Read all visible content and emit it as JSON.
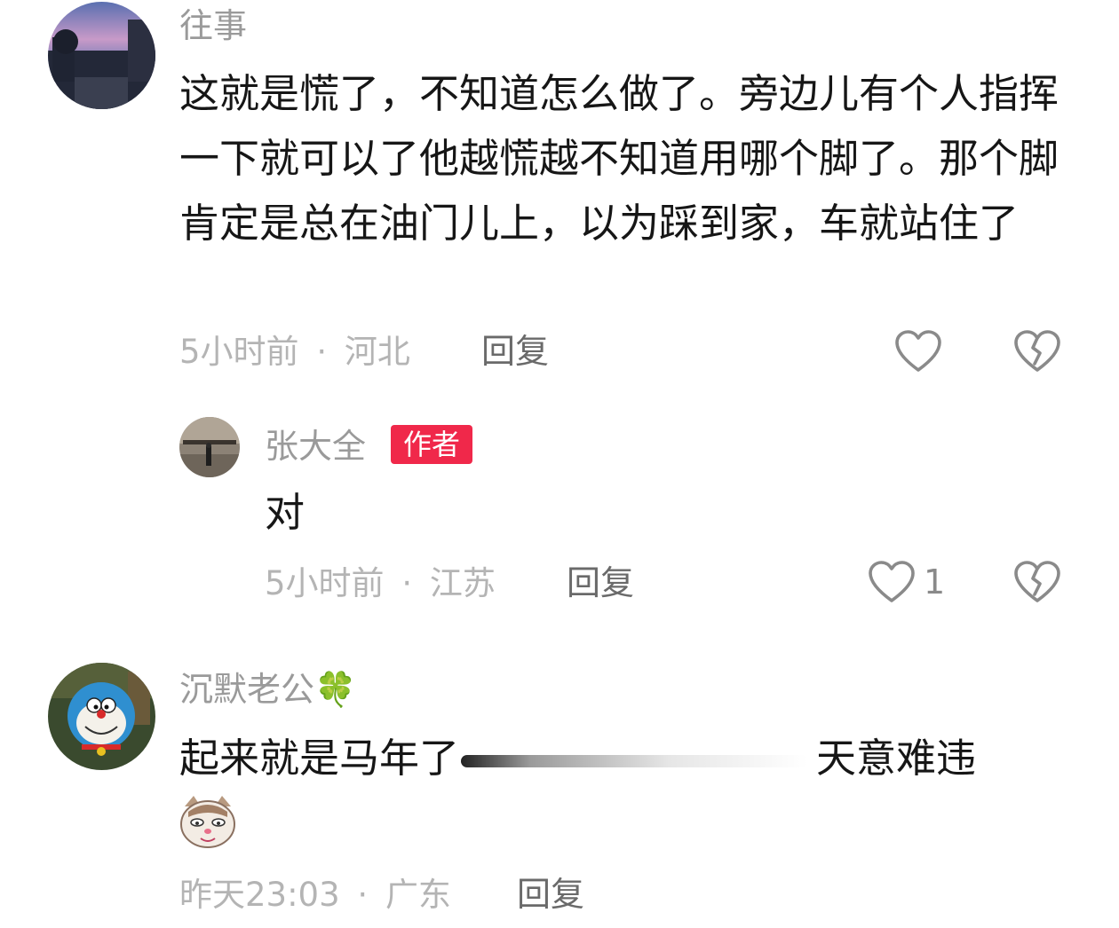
{
  "comments": [
    {
      "username": "往事",
      "text": "这就是慌了，不知道怎么做了。旁边儿有个人指挥一下就可以了他越慌越不知道用哪个脚了。那个脚肯定是总在油门儿上，以为踩到家，车就站住了",
      "time": "5小时前",
      "sep": "·",
      "location": "河北",
      "reply_label": "回复",
      "reply": {
        "username": "张大全",
        "badge": "作者",
        "text": "对",
        "time": "5小时前",
        "sep": "·",
        "location": "江苏",
        "reply_label": "回复",
        "like_count": "1"
      }
    },
    {
      "username": "沉默老公",
      "username_emoji": "🍀",
      "text_before": "起来就是马年了",
      "text_after": "天意难违",
      "time": "昨天23:03",
      "sep": "·",
      "location": "广东",
      "reply_label": "回复"
    }
  ],
  "icons": {
    "like": "heart-outline-icon",
    "dislike": "broken-heart-icon"
  },
  "colors": {
    "badge": "#f0284a",
    "username": "#9a9a9a",
    "meta": "#b4b4b4"
  }
}
